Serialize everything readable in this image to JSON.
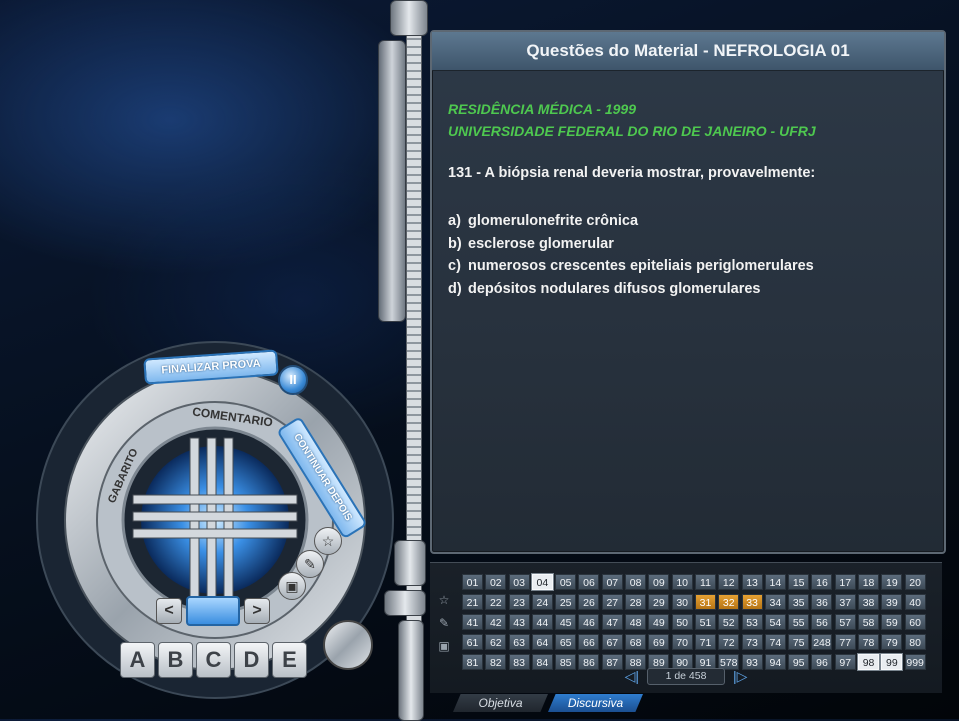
{
  "panel": {
    "title": "Questões do Material - NEFROLOGIA 01",
    "source_line1": "RESIDÊNCIA MÉDICA - 1999",
    "source_line2": "UNIVERSIDADE FEDERAL DO RIO DE JANEIRO - UFRJ",
    "question": "131 - A biópsia renal deveria mostrar, provavelmente:",
    "options": [
      {
        "letter": "a)",
        "text": "glomerulonefrite crônica"
      },
      {
        "letter": "b)",
        "text": "esclerose glomerular"
      },
      {
        "letter": "c)",
        "text": "numerosos crescentes epiteliais periglomerulares"
      },
      {
        "letter": "d)",
        "text": "depósitos nodulares difusos glomerulares"
      }
    ]
  },
  "grid": {
    "cells": [
      "01",
      "02",
      "03",
      "04",
      "05",
      "06",
      "07",
      "08",
      "09",
      "10",
      "11",
      "12",
      "13",
      "14",
      "15",
      "16",
      "17",
      "18",
      "19",
      "20",
      "21",
      "22",
      "23",
      "24",
      "25",
      "26",
      "27",
      "28",
      "29",
      "30",
      "31",
      "32",
      "33",
      "34",
      "35",
      "36",
      "37",
      "38",
      "39",
      "40",
      "41",
      "42",
      "43",
      "44",
      "45",
      "46",
      "47",
      "48",
      "49",
      "50",
      "51",
      "52",
      "53",
      "54",
      "55",
      "56",
      "57",
      "58",
      "59",
      "60",
      "61",
      "62",
      "63",
      "64",
      "65",
      "66",
      "67",
      "68",
      "69",
      "70",
      "71",
      "72",
      "73",
      "74",
      "75",
      "248",
      "77",
      "78",
      "79",
      "80",
      "81",
      "82",
      "83",
      "84",
      "85",
      "86",
      "87",
      "88",
      "89",
      "90",
      "91",
      "578",
      "93",
      "94",
      "95",
      "96",
      "97",
      "98",
      "99",
      "999"
    ],
    "orange": [
      "31",
      "32",
      "33"
    ],
    "outlined": [
      "04",
      "98",
      "99"
    ],
    "pager_text": "1 de 458"
  },
  "tabs": [
    {
      "label": "Objetiva"
    },
    {
      "label": "Discursiva"
    }
  ],
  "dial": {
    "finalizar": "FINALIZAR PROVA",
    "continuar": "CONTINUAR DEPOIS",
    "comentario": "COMENTARIO",
    "gabarito": "GABARITO",
    "pause": "II",
    "prev": "<",
    "next": ">",
    "letters": [
      "A",
      "B",
      "C",
      "D",
      "E"
    ]
  }
}
